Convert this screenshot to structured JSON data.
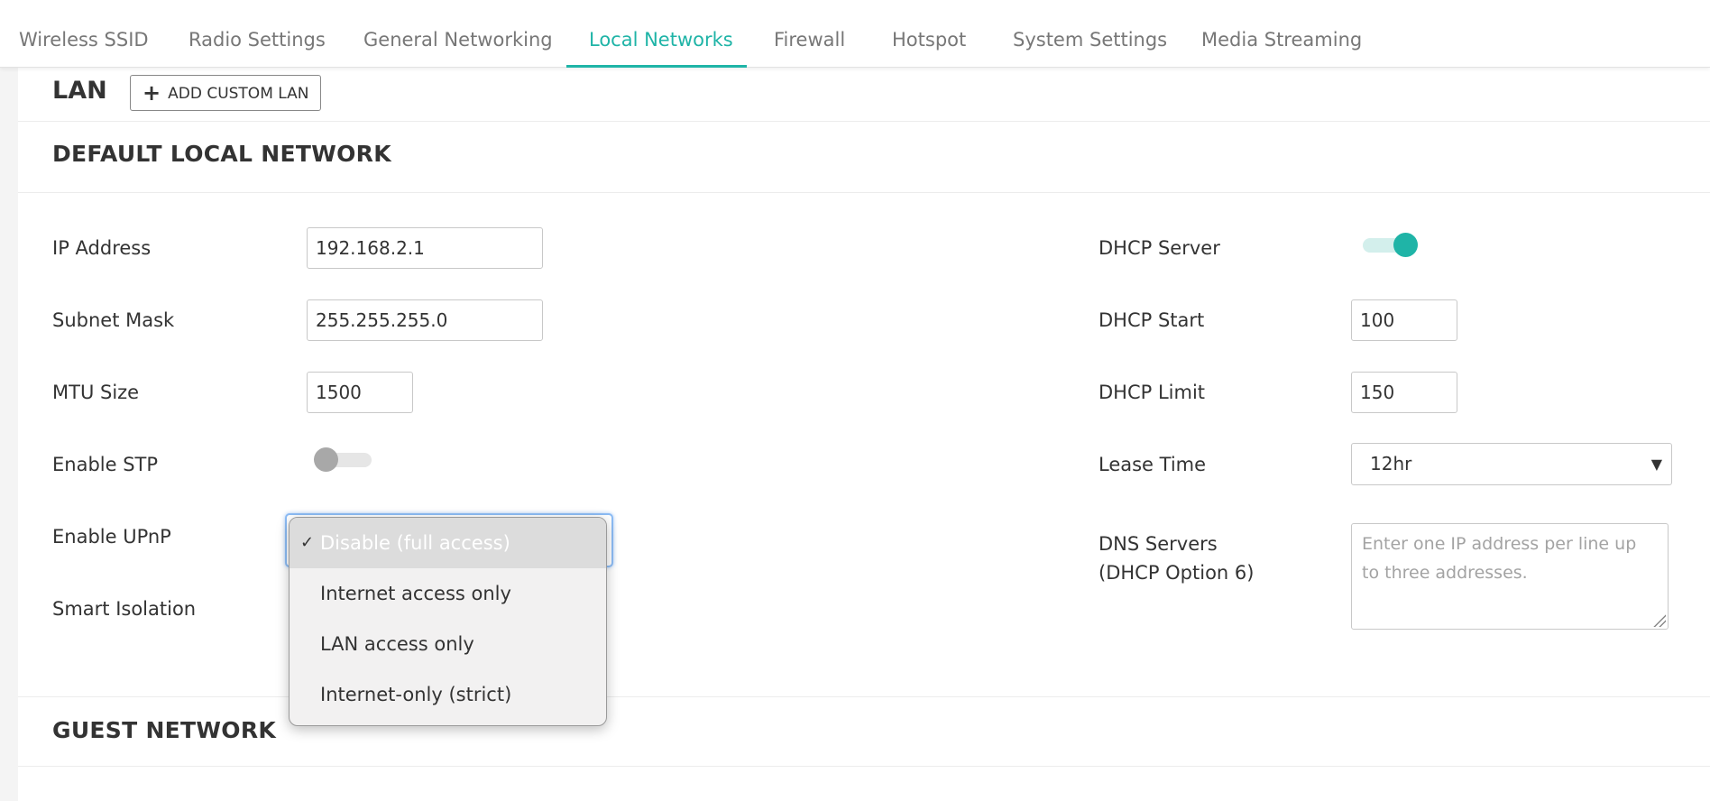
{
  "tabs": [
    {
      "label": "Wireless SSID",
      "active": false
    },
    {
      "label": "Radio Settings",
      "active": false
    },
    {
      "label": "General Networking",
      "active": false
    },
    {
      "label": "Local Networks",
      "active": true
    },
    {
      "label": "Firewall",
      "active": false
    },
    {
      "label": "Hotspot",
      "active": false
    },
    {
      "label": "System Settings",
      "active": false
    },
    {
      "label": "Media Streaming",
      "active": false
    }
  ],
  "lan": {
    "title": "LAN",
    "add_button_label": "ADD CUSTOM LAN"
  },
  "default_network": {
    "title": "DEFAULT LOCAL NETWORK",
    "ip_address": {
      "label": "IP Address",
      "value": "192.168.2.1"
    },
    "subnet_mask": {
      "label": "Subnet Mask",
      "value": "255.255.255.0"
    },
    "mtu_size": {
      "label": "MTU Size",
      "value": "1500"
    },
    "enable_stp": {
      "label": "Enable STP",
      "on": false
    },
    "enable_upnp": {
      "label": "Enable UPnP",
      "on": false
    },
    "smart_isolation": {
      "label": "Smart Isolation",
      "selected": "Disable (full access)",
      "options": [
        "Disable (full access)",
        "Internet access only",
        "LAN access only",
        "Internet-only (strict)"
      ],
      "check_mark": "✓"
    },
    "dhcp_server": {
      "label": "DHCP Server",
      "on": true
    },
    "dhcp_start": {
      "label": "DHCP Start",
      "value": "100"
    },
    "dhcp_limit": {
      "label": "DHCP Limit",
      "value": "150"
    },
    "lease_time": {
      "label": "Lease Time",
      "value": "12hr",
      "caret": "▼"
    },
    "dns_servers": {
      "label_line1": "DNS Servers",
      "label_line2": "(DHCP Option 6)",
      "placeholder": "Enter one IP address per line up to three addresses."
    }
  },
  "guest_network": {
    "title": "GUEST NETWORK"
  },
  "colors": {
    "accent": "#1fb4a7",
    "focus": "#8cbcf5",
    "text": "#333333",
    "muted": "#777777"
  },
  "icons": {
    "add": "plus-icon",
    "caret": "caret-down-icon",
    "check": "checkmark-icon"
  }
}
